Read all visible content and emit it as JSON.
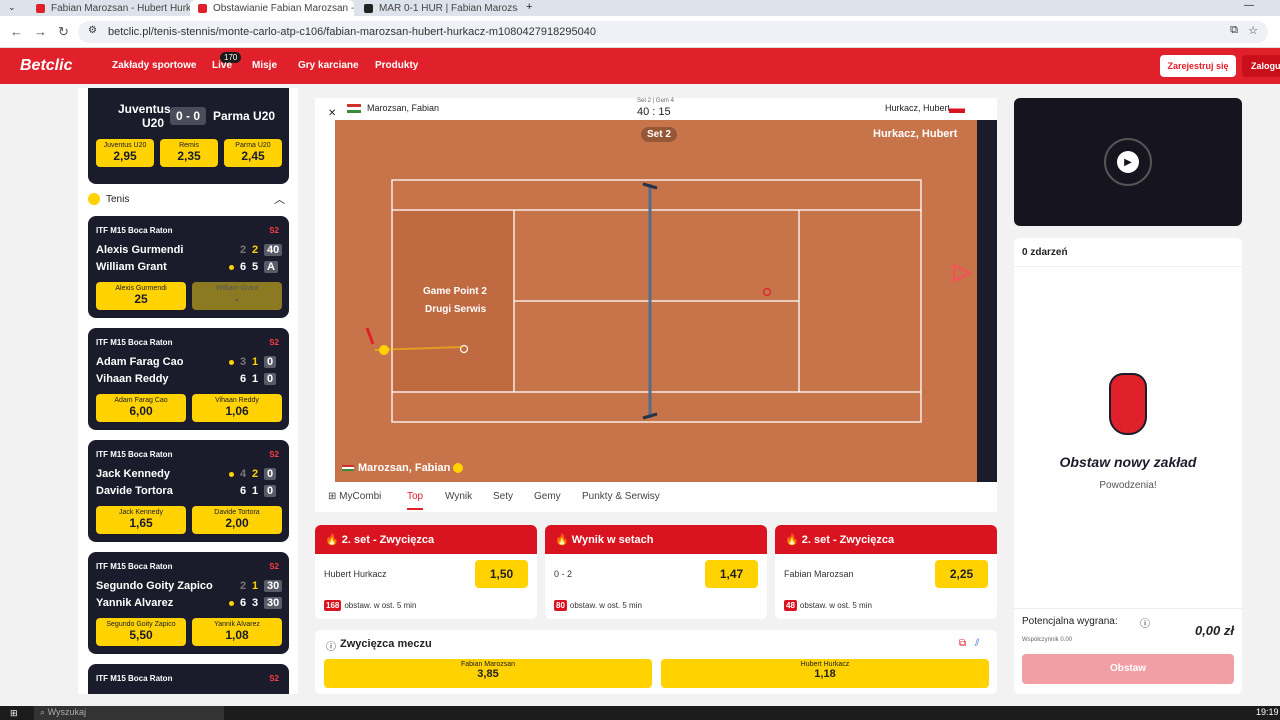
{
  "browser": {
    "tabs": [
      {
        "title": "Fabian Marozsan - Hubert Hurk",
        "active": false,
        "color": "#e0202a"
      },
      {
        "title": "Obstawianie Fabian Marozsan -",
        "active": true,
        "color": "#e0202a"
      },
      {
        "title": "MAR 0-1 HUR | Fabian Marozsa",
        "active": false,
        "color": "#222222"
      }
    ],
    "url": "betclic.pl/tenis-stennis/monte-carlo-atp-c106/fabian-marozsan-hubert-hurkacz-m1080427918295040"
  },
  "header": {
    "logo": "Betclic",
    "nav": [
      "Zakłady sportowe",
      "Live",
      "Misje",
      "Gry karciane",
      "Produkty"
    ],
    "live_count": "170",
    "register": "Zarejestruj się",
    "login": "Zaloguj"
  },
  "sidebar": {
    "football": {
      "home": "Juventus",
      "home2": "U20",
      "score": "0 - 0",
      "away": "Parma U20",
      "odds": [
        {
          "n": "Juventus U20",
          "v": "2,95"
        },
        {
          "n": "Remis",
          "v": "2,35"
        },
        {
          "n": "Parma U20",
          "v": "2,45"
        }
      ]
    },
    "section": "Tenis",
    "matches": [
      {
        "league": "ITF M15 Boca Raton",
        "set": "S2",
        "p1": "Alexis Gurmendi",
        "p2": "William Grant",
        "s1": [
          "2",
          "2",
          "40"
        ],
        "s2": [
          "6",
          "5",
          "A"
        ],
        "serve": 2,
        "o1": {
          "n": "Alexis Gurmendi",
          "v": "25"
        },
        "o2": {
          "n": "William Grant",
          "v": "-"
        }
      },
      {
        "league": "ITF M15 Boca Raton",
        "set": "S2",
        "p1": "Adam Farag Cao",
        "p2": "Vihaan Reddy",
        "s1": [
          "3",
          "1",
          "0"
        ],
        "s2": [
          "6",
          "1",
          "0"
        ],
        "serve": 1,
        "o1": {
          "n": "Adam Farag Cao",
          "v": "6,00"
        },
        "o2": {
          "n": "Vihaan Reddy",
          "v": "1,06"
        }
      },
      {
        "league": "ITF M15 Boca Raton",
        "set": "S2",
        "p1": "Jack Kennedy",
        "p2": "Davide Tortora",
        "s1": [
          "4",
          "2",
          "0"
        ],
        "s2": [
          "6",
          "1",
          "0"
        ],
        "serve": 1,
        "o1": {
          "n": "Jack Kennedy",
          "v": "1,65"
        },
        "o2": {
          "n": "Davide Tortora",
          "v": "2,00"
        }
      },
      {
        "league": "ITF M15 Boca Raton",
        "set": "S2",
        "p1": "Segundo Goity Zapico",
        "p2": "Yannik Alvarez",
        "s1": [
          "2",
          "1",
          "30"
        ],
        "s2": [
          "6",
          "3",
          "30"
        ],
        "serve": 2,
        "o1": {
          "n": "Segundo Goity Zapico",
          "v": "5,50"
        },
        "o2": {
          "n": "Yannik Alvarez",
          "v": "1,08"
        }
      },
      {
        "league": "ITF M15 Boca Raton",
        "set": "S2"
      }
    ]
  },
  "court": {
    "p1": "Marozsan, Fabian",
    "p2": "Hurkacz, Hubert",
    "set_game": "Set 2 | Gem 4",
    "points": "40 : 15",
    "set_label": "Set 2",
    "p2_label": "Hurkacz, Hubert",
    "p1_label": "Marozsan, Fabian",
    "annotation1": "Game Point 2",
    "annotation2": "Drugi Serwis"
  },
  "subtabs": [
    "MyCombi",
    "Top",
    "Wynik",
    "Sety",
    "Gemy",
    "Punkty & Serwisy"
  ],
  "markets": [
    {
      "title": "2. set - Zwycięzca",
      "label": "Hubert Hurkacz",
      "odd": "1,50",
      "count": "168",
      "footer": "obstaw. w ost. 5 min"
    },
    {
      "title": "Wynik w setach",
      "label": "0 - 2",
      "odd": "1,47",
      "count": "80",
      "footer": "obstaw. w ost. 5 min"
    },
    {
      "title": "2. set - Zwycięzca",
      "label": "Fabian Marozsan",
      "odd": "2,25",
      "count": "48",
      "footer": "obstaw. w ost. 5 min"
    }
  ],
  "winner": {
    "title": "Zwycięzca meczu",
    "o1": {
      "n": "Fabian Marozsan",
      "v": "3,85"
    },
    "o2": {
      "n": "Hubert Hurkacz",
      "v": "1,18"
    }
  },
  "betslip": {
    "events": "0 zdarzeń",
    "title": "Obstaw nowy zakład",
    "subtitle": "Powodzenia!",
    "potential": "Potencjalna wygrana:",
    "coef": "Współczynnik 0.00",
    "amount": "0,00 zł",
    "button": "Obstaw"
  },
  "taskbar": {
    "search": "Wyszukaj",
    "time": "19:19"
  }
}
